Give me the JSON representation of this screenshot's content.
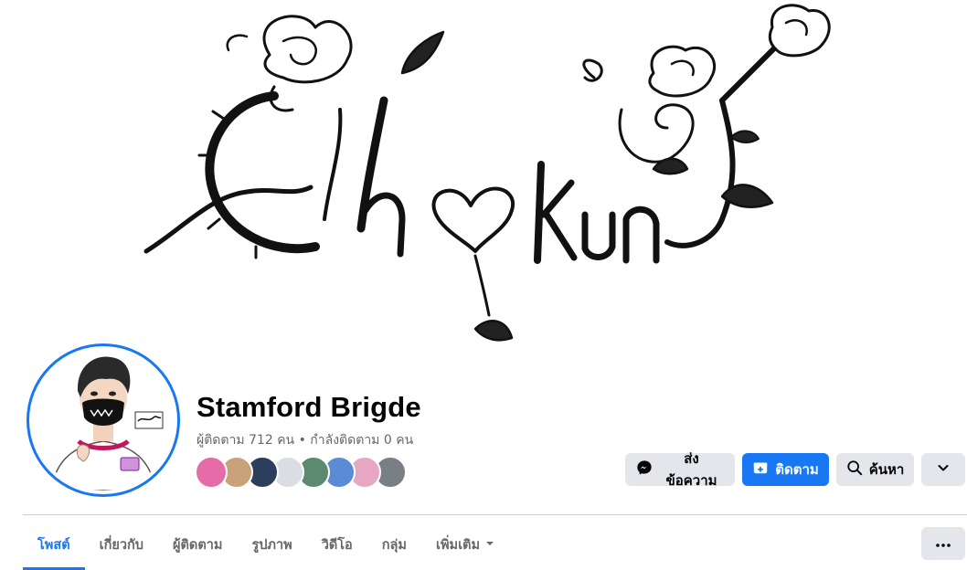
{
  "cover": {
    "logo_text": "Chokun",
    "description_icon": "rose-vine-logo"
  },
  "profile": {
    "name": "Stamford Brigde",
    "stats": "ผู้ติดตาม 712 คน • กำลังติดตาม 0 คน"
  },
  "follower_avatars": [
    {
      "color": "#e56ca8"
    },
    {
      "color": "#c9a27a"
    },
    {
      "color": "#2b3f5c"
    },
    {
      "color": "#dadde1"
    },
    {
      "color": "#5c8a6e"
    },
    {
      "color": "#5b8bd4"
    },
    {
      "color": "#e6a7c3"
    },
    {
      "color": "#7a7f85"
    }
  ],
  "actions": {
    "message_label": "ส่งข้อความ",
    "follow_label": "ติดตาม",
    "search_label": "ค้นหา",
    "message_icon": "messenger-icon",
    "follow_icon": "follow-icon",
    "search_icon": "search-icon",
    "dropdown_icon": "chevron-down-icon"
  },
  "tabs": [
    {
      "label": "โพสต์",
      "active": true
    },
    {
      "label": "เกี่ยวกับ",
      "active": false
    },
    {
      "label": "ผู้ติดตาม",
      "active": false
    },
    {
      "label": "รูปภาพ",
      "active": false
    },
    {
      "label": "วิดีโอ",
      "active": false
    },
    {
      "label": "กลุ่ม",
      "active": false
    },
    {
      "label": "เพิ่มเติม",
      "active": false
    }
  ],
  "colors": {
    "accent": "#1877f2",
    "secondary_text": "#65676b",
    "button_gray": "#e4e6eb"
  }
}
